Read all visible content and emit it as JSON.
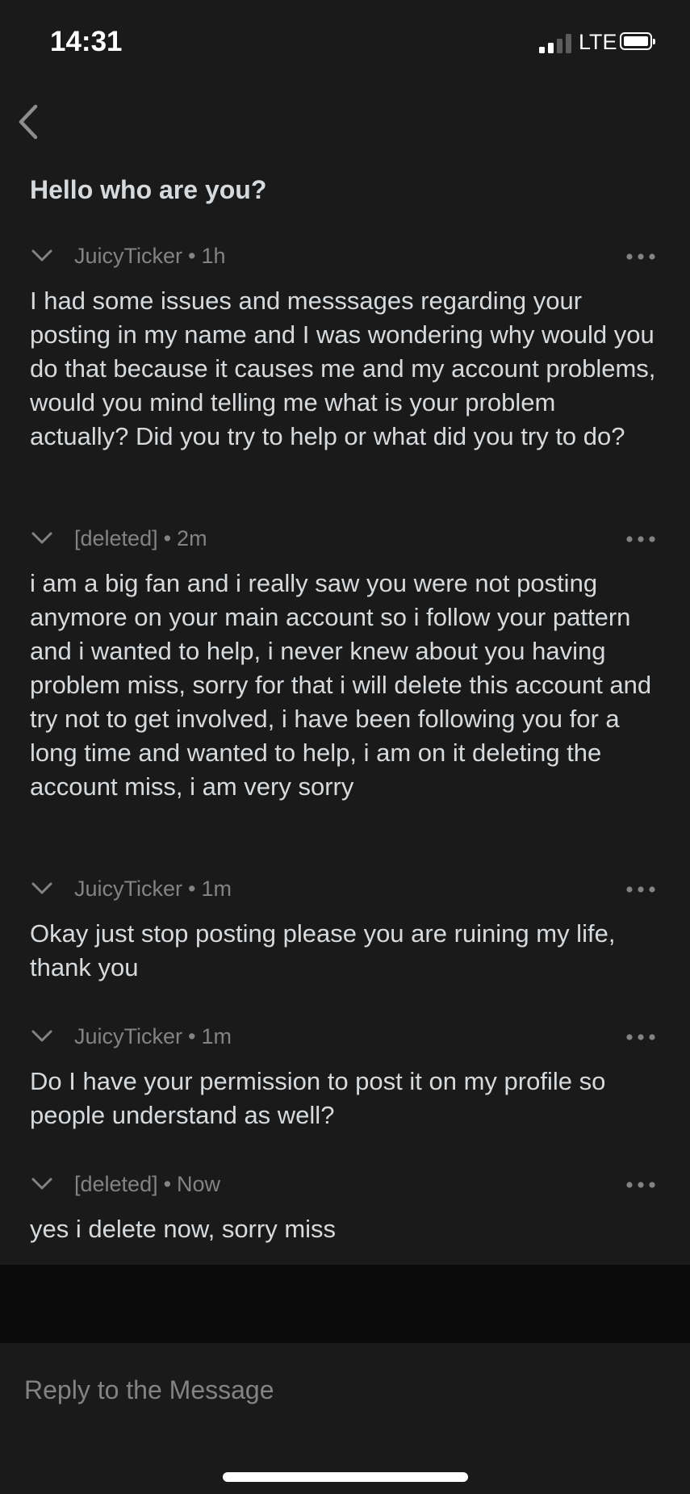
{
  "status_bar": {
    "time": "14:31",
    "network": "LTE"
  },
  "thread": {
    "title": "Hello who are you?"
  },
  "comments": [
    {
      "author": "JuicyTicker",
      "age": "1h",
      "body": "I had some issues and messsages regarding your posting in my name and I was wondering why would you do that because it causes me and my account problems, would you mind telling me what is your problem actually? Did you try to help or what did you try to do?"
    },
    {
      "author": "[deleted]",
      "age": "2m",
      "body": "i am a big fan and i really saw you were not posting anymore on your main account so i follow your pattern and i wanted to help, i never knew about you having problem miss, sorry for that i will delete this account and try not to get involved, i have been following you for a long time and wanted to help, i am on it deleting the account miss, i am very sorry"
    },
    {
      "author": "JuicyTicker",
      "age": "1m",
      "body": "Okay just stop posting please you are ruining my life, thank you"
    },
    {
      "author": "JuicyTicker",
      "age": "1m",
      "body": "Do I have your permission to post it on my profile so people understand as well?"
    },
    {
      "author": "[deleted]",
      "age": "Now",
      "body": "yes i delete now, sorry miss"
    }
  ],
  "separator": "•",
  "reply": {
    "placeholder": "Reply to the Message"
  },
  "icons": {
    "back": "chevron-left-icon",
    "collapse": "chevron-down-icon",
    "more": "more-horizontal-icon",
    "signal": "cellular-signal-icon",
    "battery": "battery-icon"
  },
  "colors": {
    "background": "#1a1a1b",
    "text": "#d7dadc",
    "meta": "#818384",
    "reply_gap": "#0b0b0c"
  }
}
